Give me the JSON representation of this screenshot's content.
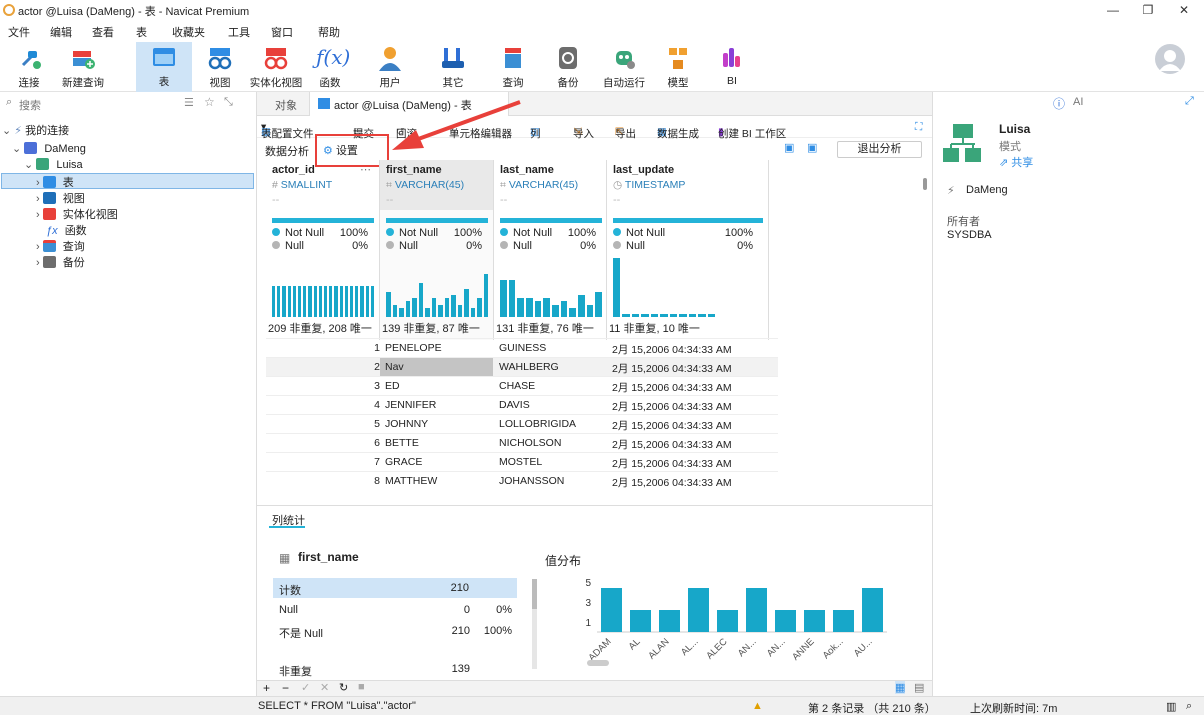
{
  "window": {
    "title": "actor @Luisa (DaMeng) - 表 - Navicat Premium"
  },
  "menu": [
    "文件",
    "编辑",
    "查看",
    "表",
    "收藏夹",
    "工具",
    "窗口",
    "帮助"
  ],
  "toolbar": {
    "connect": "连接",
    "new_query": "新建查询",
    "table": "表",
    "view": "视图",
    "mat_view": "实体化视图",
    "function": "函数",
    "user": "用户",
    "other": "其它",
    "query": "查询",
    "backup": "备份",
    "auto_run": "自动运行",
    "model": "模型",
    "bi": "BI"
  },
  "left": {
    "search_placeholder": "搜索",
    "my_connections": "我的连接",
    "connection": "DaMeng",
    "schema": "Luisa",
    "items": [
      "表",
      "视图",
      "实体化视图",
      "函数",
      "查询",
      "备份"
    ]
  },
  "tabs": {
    "objects": "对象",
    "current": "actor @Luisa (DaMeng) - 表"
  },
  "table_toolbar": {
    "profile": "表配置文件",
    "commit": "提交",
    "rollback": "回滚",
    "cell_editor": "单元格编辑器",
    "columns": "列",
    "import": "导入",
    "export": "导出",
    "data_gen": "数据生成",
    "create_bi": "创建 BI 工作区"
  },
  "analysis": {
    "label": "数据分析",
    "settings": "设置",
    "exit": "退出分析"
  },
  "columns": [
    {
      "name": "actor_id",
      "type": "SMALLINT",
      "notnull_label": "Not Null",
      "notnull_pct": "100%",
      "null_label": "Null",
      "null_pct": "0%",
      "distinct": "209 非重复, 208 唯一"
    },
    {
      "name": "first_name",
      "type": "VARCHAR(45)",
      "notnull_label": "Not Null",
      "notnull_pct": "100%",
      "null_label": "Null",
      "null_pct": "0%",
      "distinct": "139 非重复, 87 唯一"
    },
    {
      "name": "last_name",
      "type": "VARCHAR(45)",
      "notnull_label": "Not Null",
      "notnull_pct": "100%",
      "null_label": "Null",
      "null_pct": "0%",
      "distinct": "131 非重复, 76 唯一"
    },
    {
      "name": "last_update",
      "type": "TIMESTAMP",
      "notnull_label": "Not Null",
      "notnull_pct": "100%",
      "null_label": "Null",
      "null_pct": "0%",
      "distinct": "11 非重复, 10 唯一"
    }
  ],
  "rows": [
    {
      "id": "1",
      "first": "PENELOPE",
      "last": "GUINESS",
      "update": "2月 15,2006 04:34:33 AM"
    },
    {
      "id": "2",
      "first": "Nav",
      "last": "WAHLBERG",
      "update": "2月 15,2006 04:34:33 AM"
    },
    {
      "id": "3",
      "first": "ED",
      "last": "CHASE",
      "update": "2月 15,2006 04:34:33 AM"
    },
    {
      "id": "4",
      "first": "JENNIFER",
      "last": "DAVIS",
      "update": "2月 15,2006 04:34:33 AM"
    },
    {
      "id": "5",
      "first": "JOHNNY",
      "last": "LOLLOBRIGIDA",
      "update": "2月 15,2006 04:34:33 AM"
    },
    {
      "id": "6",
      "first": "BETTE",
      "last": "NICHOLSON",
      "update": "2月 15,2006 04:34:33 AM"
    },
    {
      "id": "7",
      "first": "GRACE",
      "last": "MOSTEL",
      "update": "2月 15,2006 04:34:33 AM"
    },
    {
      "id": "8",
      "first": "MATTHEW",
      "last": "JOHANSSON",
      "update": "2月 15,2006 04:34:33 AM"
    }
  ],
  "col_stats": {
    "tab": "列统计",
    "column": "first_name",
    "stats": [
      {
        "label": "计数",
        "value": "210",
        "pct": ""
      },
      {
        "label": "Null",
        "value": "0",
        "pct": "0%"
      },
      {
        "label": "不是 Null",
        "value": "210",
        "pct": "100%"
      },
      {
        "label": "非重复",
        "value": "139",
        "pct": ""
      }
    ],
    "dist_title": "值分布"
  },
  "chart_data": {
    "type": "bar",
    "title": "值分布",
    "categories": [
      "ADAM",
      "AL",
      "ALAN",
      "AL...",
      "ALEC",
      "AN...",
      "AN...",
      "ANNE",
      "Aok...",
      "AU..."
    ],
    "values": [
      2,
      1,
      1,
      2,
      1,
      2,
      1,
      1,
      1,
      2
    ],
    "yticks": [
      "5",
      "3",
      "1"
    ],
    "ylim": [
      0,
      5
    ],
    "color": "#17a7c9"
  },
  "right": {
    "name": "Luisa",
    "kind": "模式",
    "share": "共享",
    "connection": "DaMeng",
    "owner_label": "所有者",
    "owner": "SYSDBA",
    "ai": "AI"
  },
  "status": {
    "sql": "SELECT * FROM \"Luisa\".\"actor\"",
    "record": "第 2 条记录 （共 210 条）",
    "refresh": "上次刷新时间: 7m"
  },
  "colors": {
    "accent": "#17a7c9",
    "selection": "#cfe4f7",
    "highlight_red": "#e8403a"
  }
}
